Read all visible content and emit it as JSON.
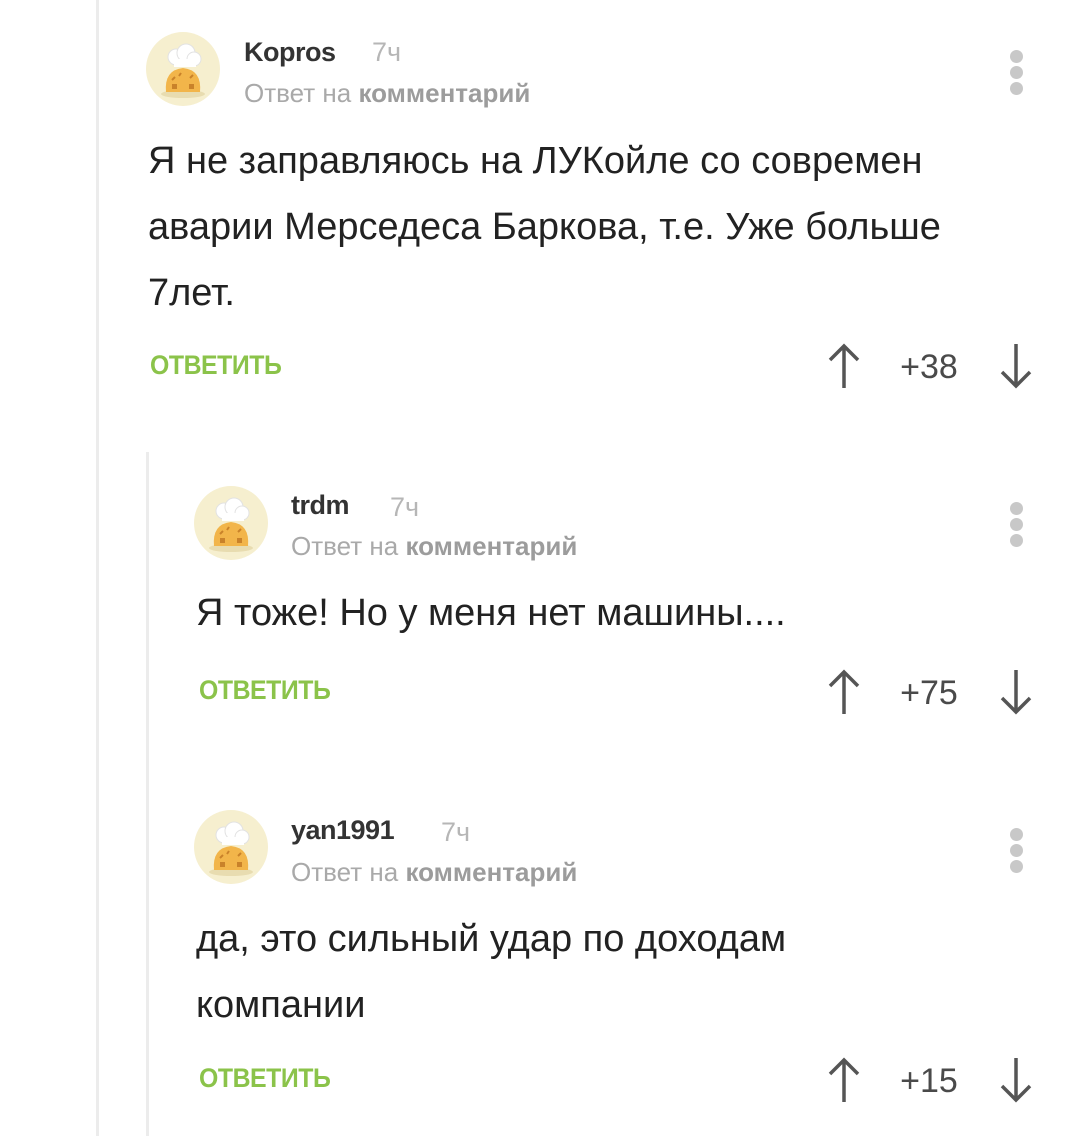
{
  "comments": [
    {
      "username": "Kopros",
      "time": "7ч",
      "reply_prefix": "Ответ на",
      "reply_link": "комментарий",
      "lines": [
        "Я не заправляюсь на ЛУКойле со современ",
        "аварии Мерседеса Баркова, т.е. Уже больше",
        "7лет."
      ],
      "reply_label": "ОТВЕТИТЬ",
      "rating": "+38"
    },
    {
      "username": "trdm",
      "time": "7ч",
      "reply_prefix": "Ответ на",
      "reply_link": "комментарий",
      "lines": [
        "Я тоже! Но у меня нет машины...."
      ],
      "reply_label": "ОТВЕТИТЬ",
      "rating": "+75"
    },
    {
      "username": "yan1991",
      "time": "7ч",
      "reply_prefix": "Ответ на",
      "reply_link": "комментарий",
      "lines": [
        "да, это сильный удар по доходам",
        "компании"
      ],
      "reply_label": "ОТВЕТИТЬ",
      "rating": "+15"
    }
  ],
  "icons": {
    "avatar": "chef-hat-avatar-icon",
    "more": "more-vertical-icon",
    "up": "arrow-up-icon",
    "down": "arrow-down-icon"
  },
  "colors": {
    "accent": "#8bc34a",
    "muted": "#a9a9a9",
    "text": "#222222"
  }
}
